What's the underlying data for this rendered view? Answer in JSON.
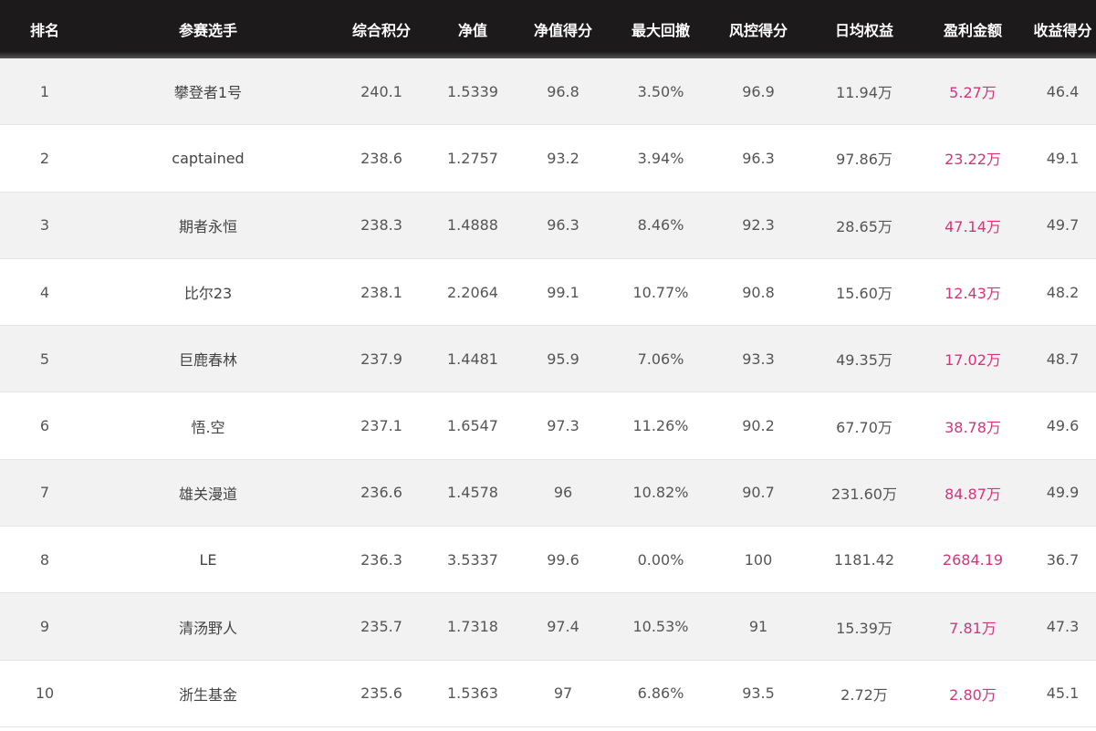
{
  "table": {
    "columns": [
      "排名",
      "参赛选手",
      "综合积分",
      "净值",
      "净值得分",
      "最大回撤",
      "风控得分",
      "日均权益",
      "盈利金额",
      "收益得分"
    ],
    "rows": [
      [
        "1",
        "攀登者1号",
        "240.1",
        "1.5339",
        "96.8",
        "3.50%",
        "96.9",
        "11.94万",
        "5.27万",
        "46.4"
      ],
      [
        "2",
        "captained",
        "238.6",
        "1.2757",
        "93.2",
        "3.94%",
        "96.3",
        "97.86万",
        "23.22万",
        "49.1"
      ],
      [
        "3",
        "期者永恒",
        "238.3",
        "1.4888",
        "96.3",
        "8.46%",
        "92.3",
        "28.65万",
        "47.14万",
        "49.7"
      ],
      [
        "4",
        "比尔23",
        "238.1",
        "2.2064",
        "99.1",
        "10.77%",
        "90.8",
        "15.60万",
        "12.43万",
        "48.2"
      ],
      [
        "5",
        "巨鹿春林",
        "237.9",
        "1.4481",
        "95.9",
        "7.06%",
        "93.3",
        "49.35万",
        "17.02万",
        "48.7"
      ],
      [
        "6",
        "悟.空",
        "237.1",
        "1.6547",
        "97.3",
        "11.26%",
        "90.2",
        "67.70万",
        "38.78万",
        "49.6"
      ],
      [
        "7",
        "雄关漫道",
        "236.6",
        "1.4578",
        "96",
        "10.82%",
        "90.7",
        "231.60万",
        "84.87万",
        "49.9"
      ],
      [
        "8",
        "LE",
        "236.3",
        "3.5337",
        "99.6",
        "0.00%",
        "100",
        "1181.42",
        "2684.19",
        "36.7"
      ],
      [
        "9",
        "清汤野人",
        "235.7",
        "1.7318",
        "97.4",
        "10.53%",
        "91",
        "15.39万",
        "7.81万",
        "47.3"
      ],
      [
        "10",
        "浙生基金",
        "235.6",
        "1.5363",
        "97",
        "6.86%",
        "93.5",
        "2.72万",
        "2.80万",
        "45.1"
      ]
    ]
  },
  "colors": {
    "header_bg": "#1c1a1b",
    "profit_text": "#d6337a",
    "stripe_bg": "#f2f2f2"
  }
}
